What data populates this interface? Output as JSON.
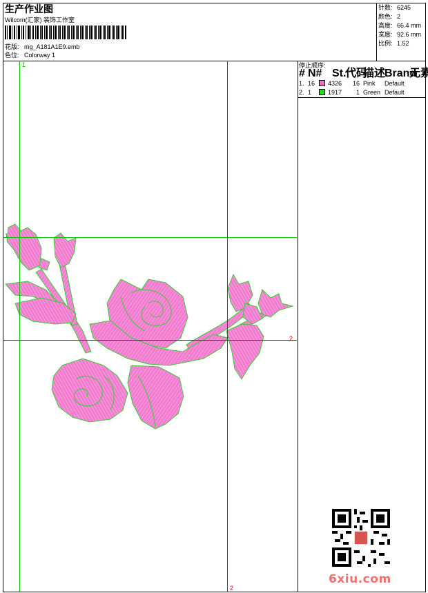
{
  "header": {
    "title": "生产作业图",
    "subtitle": "Wilcom(汇家) 装饰工作室",
    "design_label": "花版:",
    "design_value": "mg_A181A1E9.emb",
    "colorway_label": "色位:",
    "colorway_value": "Colorway 1"
  },
  "stats": [
    {
      "label": "针数:",
      "value": "6245"
    },
    {
      "label": "颜色:",
      "value": "2"
    },
    {
      "label": "高度:",
      "value": "66.4 mm"
    },
    {
      "label": "宽度:",
      "value": "92.6 mm"
    },
    {
      "label": "比例:",
      "value": "1.52"
    }
  ],
  "stop_sequence": {
    "title": "停止顺序:",
    "columns": [
      "#",
      "N#",
      "St.",
      "代码",
      "描述",
      "Brand",
      "元素"
    ],
    "rows": [
      {
        "index": "1.",
        "needle": "16",
        "swatch": "#f06ec8",
        "stitches": "4326",
        "code": "16",
        "desc": "Pink",
        "brand": "Default"
      },
      {
        "index": "2.",
        "needle": "1",
        "swatch": "#22dd22",
        "stitches": "1917",
        "code": "1",
        "desc": "Green",
        "brand": "Default"
      }
    ]
  },
  "guides": {
    "v_green_label": "1",
    "h_green_label": "1",
    "v_red_label": "2",
    "h_red_label": "2"
  },
  "colors": {
    "pink_thread": "#f27ccf",
    "green_outline": "#2fd12f",
    "guide_red": "#ee0000",
    "guide_green": "#00cc00"
  },
  "watermark": {
    "site": "6xiu.com"
  }
}
